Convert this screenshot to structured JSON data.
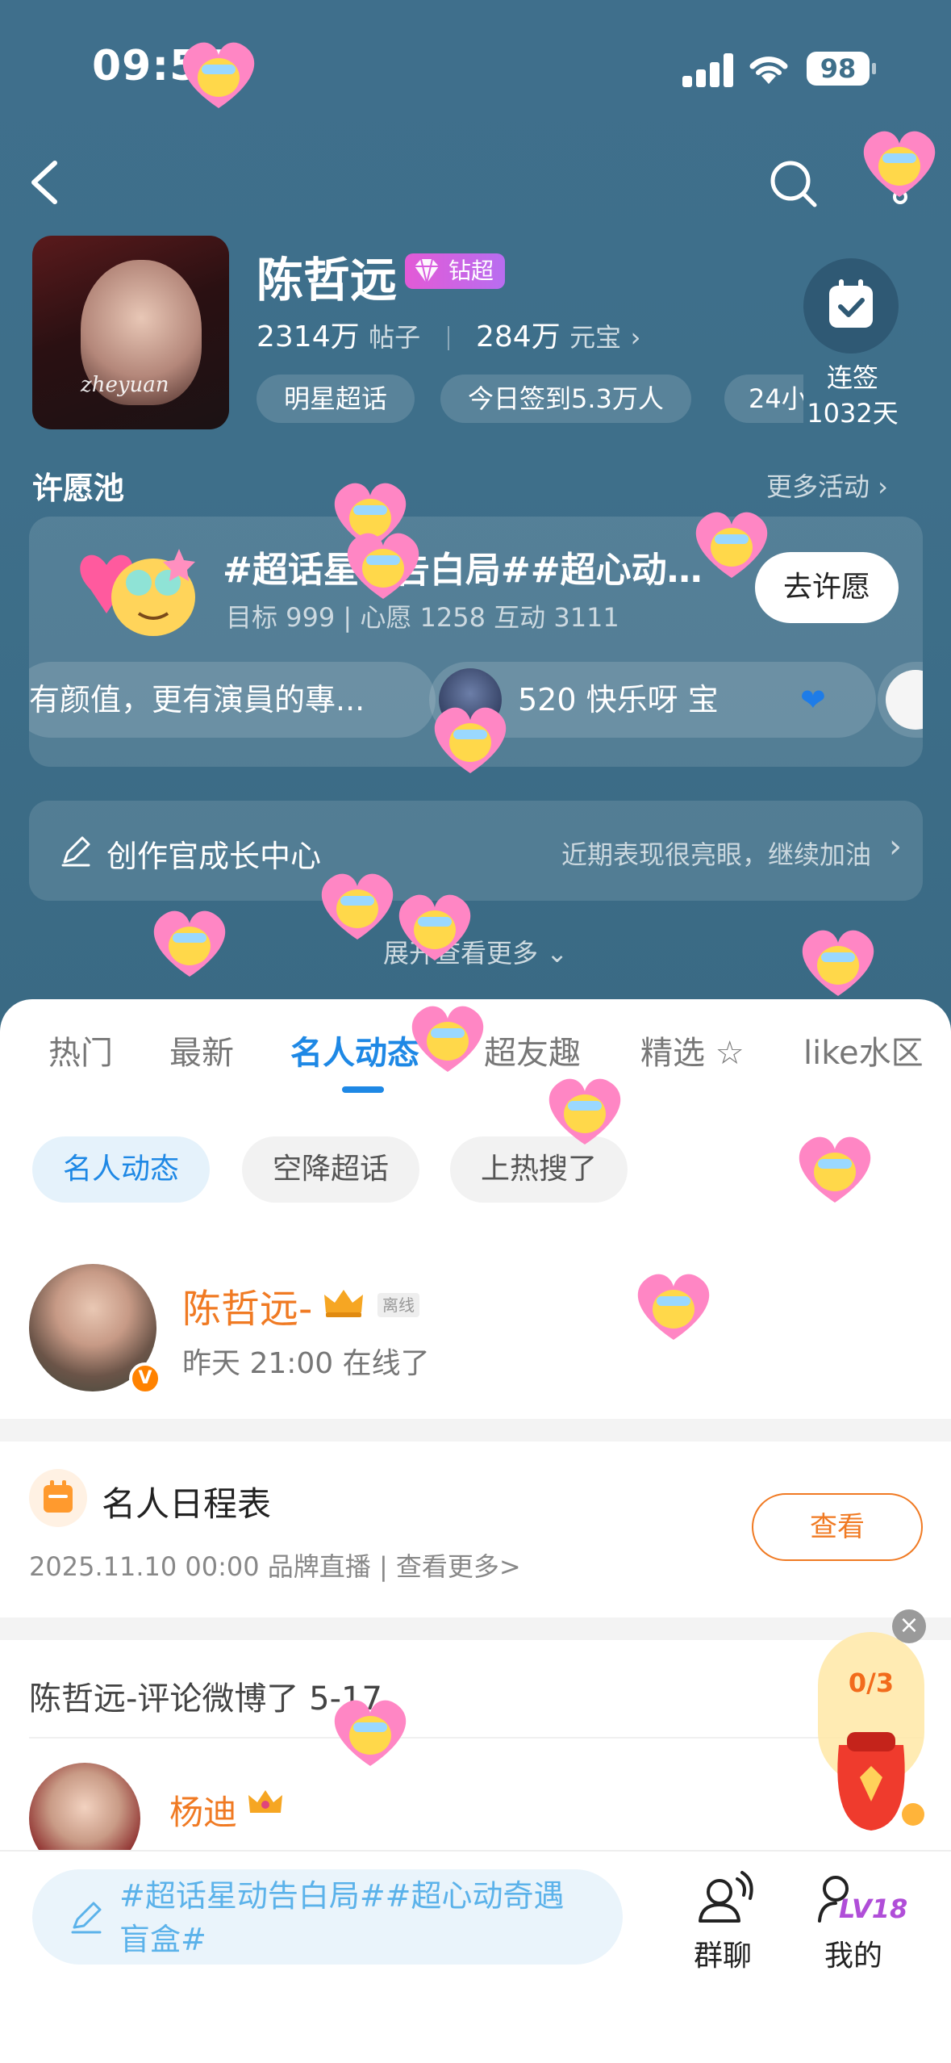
{
  "status_bar": {
    "time": "09:54",
    "battery": "98"
  },
  "header": {
    "star_name": "陈哲远",
    "diamond_badge": "钻超",
    "posts_count": "2314万",
    "posts_unit": "帖子",
    "yuanbao_count": "284万",
    "yuanbao_unit": "元宝",
    "cover_signature": "zheyuan",
    "chips": [
      "明星超话",
      "今日签到5.3万人",
      "24小"
    ]
  },
  "checkin": {
    "label_line1": "连签",
    "label_line2": "1032天"
  },
  "wish_pool": {
    "section_title": "许愿池",
    "more_activities": "更多活动 ›",
    "title": "#超话星动告白局##超心动…",
    "meta": "目标 999  |  心愿 1258  互动 3111",
    "button": "去许愿",
    "bubbles": [
      {
        "text": "有颜值，更有演員的專..."
      },
      {
        "text": "520 快乐呀  宝"
      }
    ]
  },
  "growth_center": {
    "label": "创作官成长中心",
    "hint": "近期表现很亮眼，继续加油"
  },
  "expand_more": "展开查看更多",
  "tabs": [
    "热门",
    "最新",
    "名人动态",
    "超友趣",
    "精选",
    "like水区"
  ],
  "filters": [
    "名人动态",
    "空降超话",
    "上热搜了"
  ],
  "celebrity": {
    "name": "陈哲远-",
    "offline": "离线",
    "online_time": "昨天 21:00 在线了",
    "verified": "V"
  },
  "schedule": {
    "title": "名人日程表",
    "detail": "2025.11.10 00:00 品牌直播 |  查看更多>",
    "button": "查看"
  },
  "comment": {
    "title": "陈哲远-评论微博了 5-17",
    "user_name": "杨迪"
  },
  "gift": {
    "count": "0/3",
    "close": "×"
  },
  "bottom": {
    "compose_text": "#超话星动告白局##超心动奇遇盲盒#",
    "group_chat": "群聊",
    "mine": "我的",
    "level": "LV18"
  },
  "colors": {
    "hero_bg": "#3e6f8a",
    "accent_blue": "#1e88e5",
    "accent_orange": "#f07a23",
    "diamond": "#d95ce0"
  },
  "icons": [
    "back-icon",
    "search-icon",
    "more-icon",
    "calendar-check-icon",
    "pen-icon",
    "chevron-right-icon",
    "chevron-down-icon",
    "crown-icon",
    "group-chat-icon",
    "profile-icon",
    "compose-icon",
    "heart-sticker-icon"
  ]
}
